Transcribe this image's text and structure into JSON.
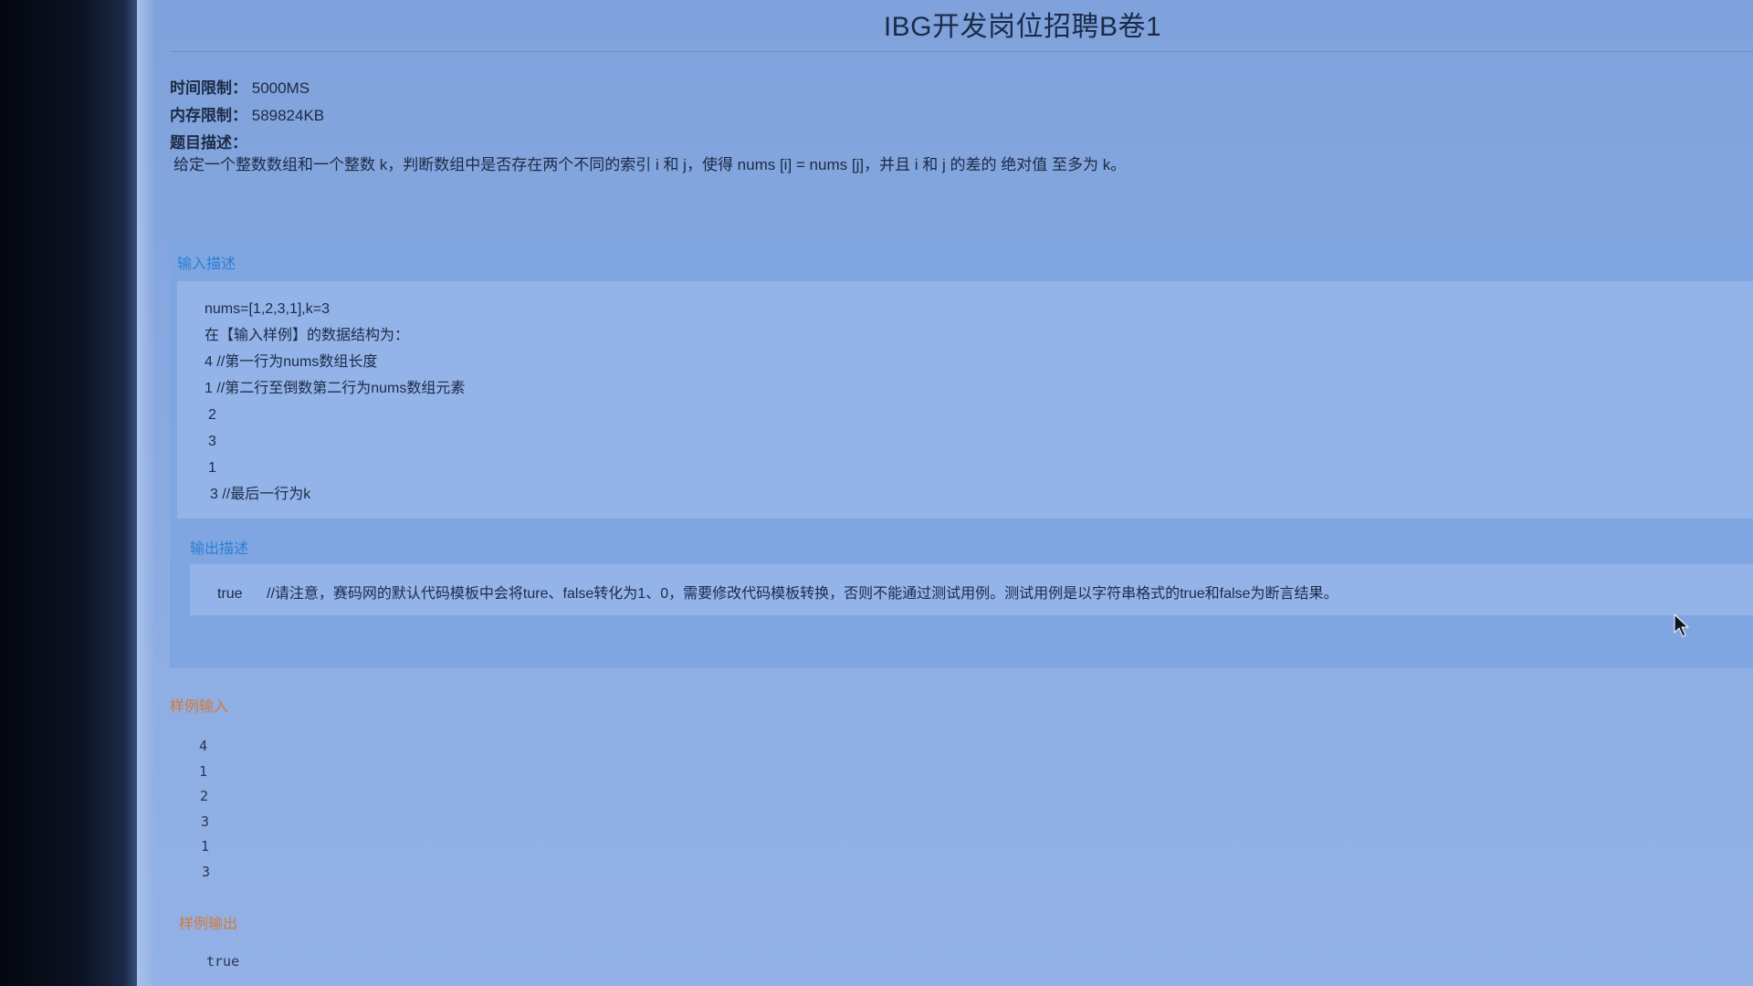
{
  "page": {
    "title": "IBG开发岗位招聘B卷1"
  },
  "meta": {
    "time_limit_label": "时间限制：",
    "time_limit_value": "5000MS",
    "memory_limit_label": "内存限制：",
    "memory_limit_value": "589824KB",
    "description_label": "题目描述：",
    "description_text": "给定一个整数数组和一个整数 k，判断数组中是否存在两个不同的索引 i 和 j，使得 nums [i] = nums [j]，并且 i 和 j 的差的 绝对值 至多为 k。"
  },
  "input_description": {
    "heading": "输入描述",
    "lines": [
      "nums=[1,2,3,1],k=3",
      "在【输入样例】的数据结构为：",
      "4  //第一行为nums数组长度",
      "1  //第二行至倒数第二行为nums数组元素",
      "2",
      "3",
      "1",
      "3 //最后一行为k"
    ]
  },
  "output_description": {
    "heading": "输出描述",
    "value": "true",
    "note": "//请注意，赛码网的默认代码模板中会将ture、false转化为1、0，需要修改代码模板转换，否则不能通过测试用例。测试用例是以字符串格式的true和false为断言结果。"
  },
  "sample_input": {
    "heading": "样例输入",
    "lines": [
      "4",
      "1",
      "2",
      "3",
      "1",
      "3"
    ]
  },
  "sample_output": {
    "heading": "样例输出",
    "lines": [
      "true"
    ]
  },
  "colors": {
    "section_blue": "#2d7fd4",
    "section_orange": "#d47a35",
    "screen_bg": "#88a9e0"
  },
  "icons": {
    "cursor": "mouse-pointer-icon"
  }
}
